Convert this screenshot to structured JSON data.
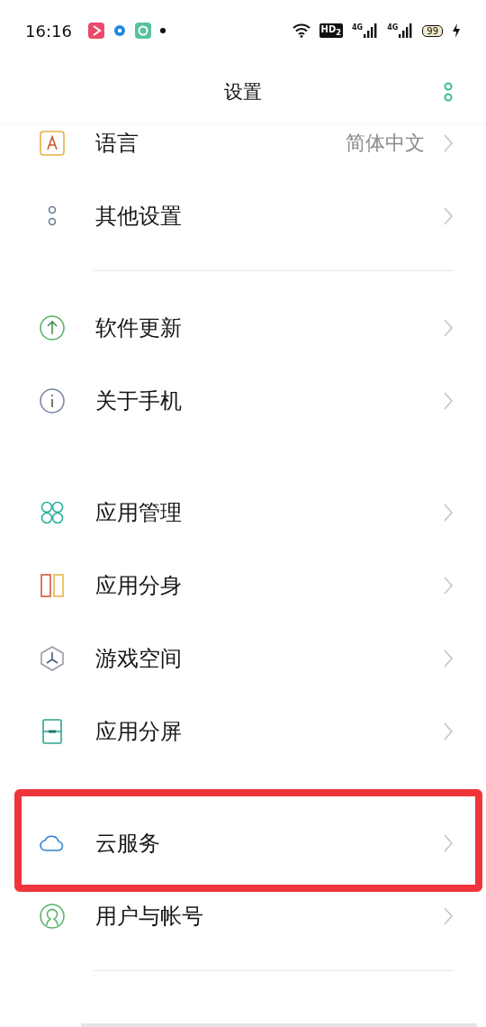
{
  "status_bar": {
    "time": "16:16",
    "hd": "HD$_{2}$",
    "signals": [
      {
        "label": "4G"
      },
      {
        "label": "4G"
      }
    ],
    "battery": "99"
  },
  "header": {
    "title": "设置"
  },
  "sections": [
    {
      "divider_after": true,
      "rows": [
        {
          "kind": "language",
          "label": "语言",
          "value": "简体中文",
          "highlighted": false
        },
        {
          "kind": "more",
          "label": "其他设置",
          "highlighted": false
        }
      ]
    },
    {
      "divider_after": false,
      "rows": [
        {
          "kind": "update",
          "label": "软件更新",
          "highlighted": false
        },
        {
          "kind": "info",
          "label": "关于手机",
          "highlighted": false
        }
      ]
    },
    {
      "divider_after": false,
      "rows": [
        {
          "kind": "apps",
          "label": "应用管理",
          "highlighted": false
        },
        {
          "kind": "clone",
          "label": "应用分身",
          "highlighted": false
        },
        {
          "kind": "game",
          "label": "游戏空间",
          "highlighted": false
        },
        {
          "kind": "split",
          "label": "应用分屏",
          "highlighted": false
        }
      ]
    },
    {
      "divider_after": true,
      "rows": [
        {
          "kind": "cloud",
          "label": "云服务",
          "highlighted": true
        },
        {
          "kind": "user",
          "label": "用户与帐号",
          "highlighted": false
        }
      ]
    }
  ]
}
